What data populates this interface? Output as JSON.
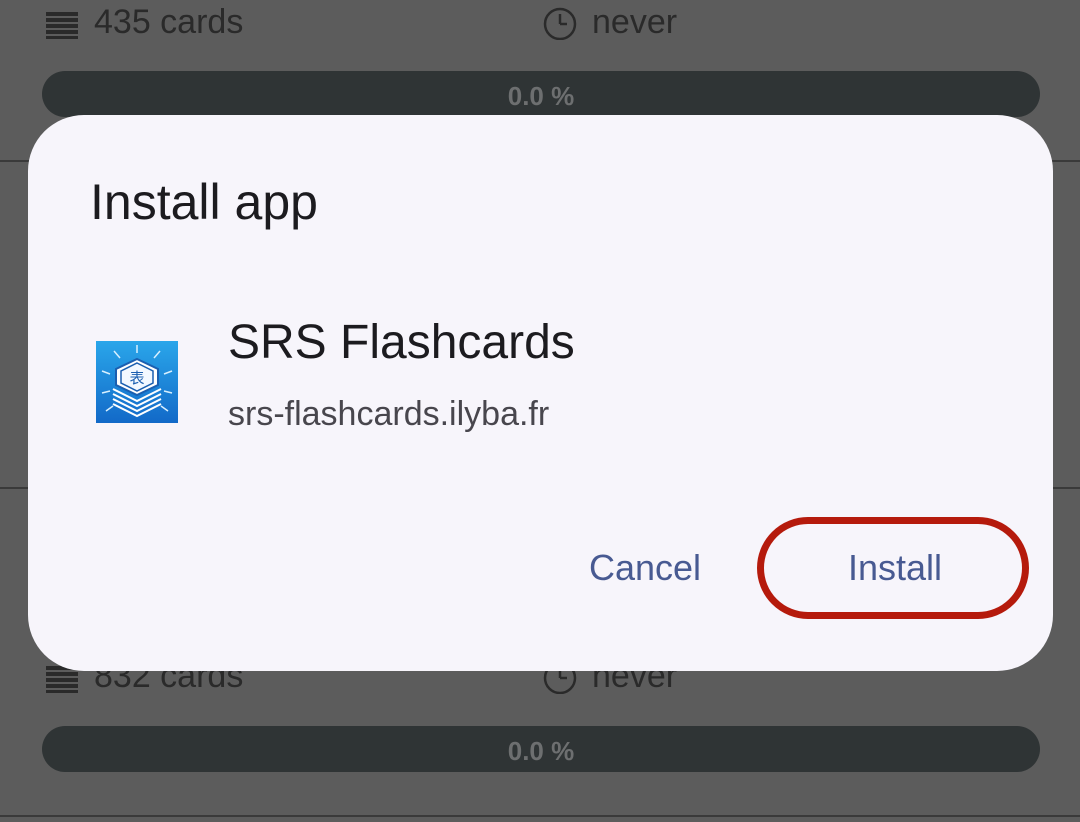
{
  "background": {
    "decks": [
      {
        "cards": "435 cards",
        "last_review": "never",
        "progress_label": "0.0 %",
        "progress": 0.0
      },
      {
        "cards": "832 cards",
        "last_review": "never",
        "progress_label": "0.0 %",
        "progress": 0.0
      }
    ]
  },
  "dialog": {
    "title": "Install app",
    "app_name": "SRS Flashcards",
    "app_url": "srs-flashcards.ilyba.fr",
    "cancel_label": "Cancel",
    "install_label": "Install"
  },
  "icons": {
    "app_icon": "srs-flashcards-app-icon",
    "cards_icon": "stack-icon",
    "clock_icon": "clock-icon"
  },
  "colors": {
    "dialog_bg": "#f7f5fb",
    "button_text": "#485a92",
    "highlight": "#b51a0c",
    "progress_track": "#2f3435"
  }
}
